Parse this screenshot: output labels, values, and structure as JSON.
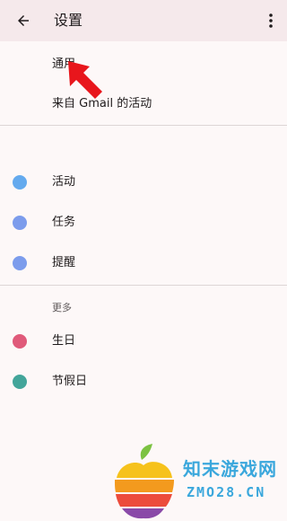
{
  "header": {
    "title": "设置",
    "back_icon": "arrow-left-icon",
    "more_icon": "more-vert-icon"
  },
  "top_items": [
    {
      "label": "通用"
    },
    {
      "label": "来自 Gmail 的活动"
    }
  ],
  "calendar_items": [
    {
      "label": "活动",
      "color": "#64aaee"
    },
    {
      "label": "任务",
      "color": "#7c9cec"
    },
    {
      "label": "提醒",
      "color": "#7c9cec"
    }
  ],
  "more_section": {
    "header": "更多",
    "items": [
      {
        "label": "生日",
        "color": "#e05a7a"
      },
      {
        "label": "节假日",
        "color": "#43a59a"
      }
    ]
  },
  "watermark": {
    "text_cn": "知末游戏网",
    "text_en": "ZMO28.CN"
  },
  "colors": {
    "header_bg": "#f5e9eb",
    "page_bg": "#fdf8f8",
    "annotation_arrow": "#e8161c"
  }
}
